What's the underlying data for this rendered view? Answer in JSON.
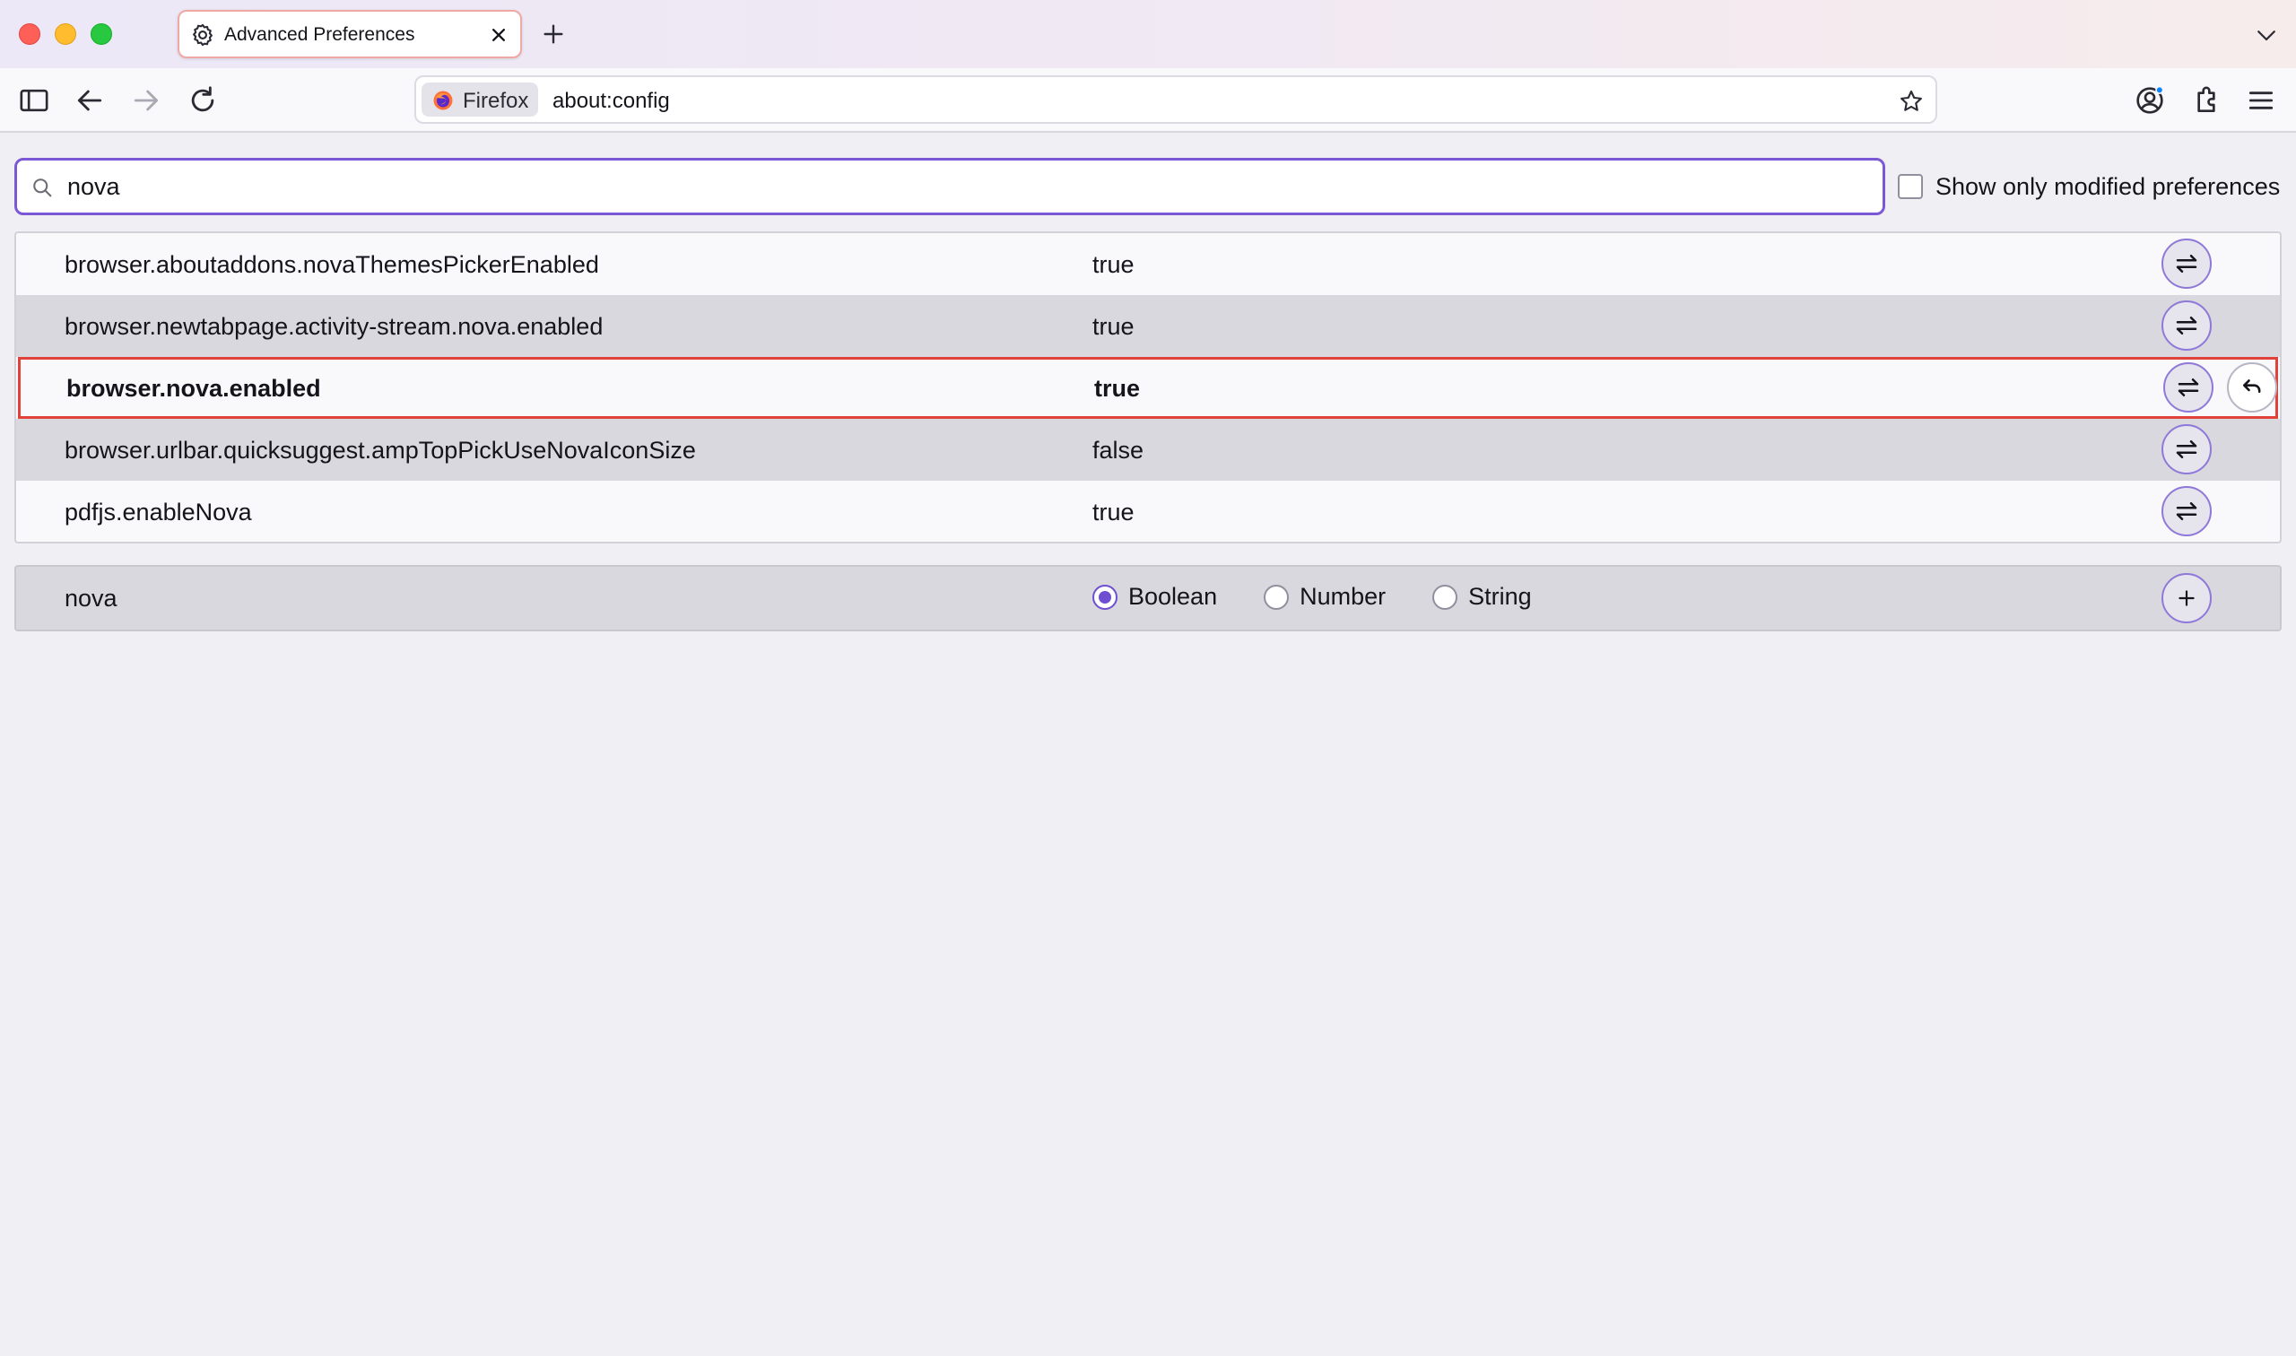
{
  "tab": {
    "title": "Advanced Preferences"
  },
  "urlbar": {
    "identity_label": "Firefox",
    "url": "about:config"
  },
  "search": {
    "value": "nova"
  },
  "filter": {
    "label": "Show only modified preferences",
    "checked": false
  },
  "prefs": [
    {
      "name": "browser.aboutaddons.novaThemesPickerEnabled",
      "value": "true",
      "modified": false
    },
    {
      "name": "browser.newtabpage.activity-stream.nova.enabled",
      "value": "true",
      "modified": false
    },
    {
      "name": "browser.nova.enabled",
      "value": "true",
      "modified": true
    },
    {
      "name": "browser.urlbar.quicksuggest.ampTopPickUseNovaIconSize",
      "value": "false",
      "modified": false
    },
    {
      "name": "pdfjs.enableNova",
      "value": "true",
      "modified": false
    }
  ],
  "new_pref": {
    "name": "nova",
    "types": [
      "Boolean",
      "Number",
      "String"
    ],
    "selected_type": "Boolean"
  },
  "icons": {
    "tab": "gear-icon",
    "toggle": "toggle-arrows-icon",
    "reset": "undo-icon",
    "add": "plus-icon"
  },
  "colors": {
    "accent": "#7b58d6",
    "highlight_border": "#e0423a"
  }
}
